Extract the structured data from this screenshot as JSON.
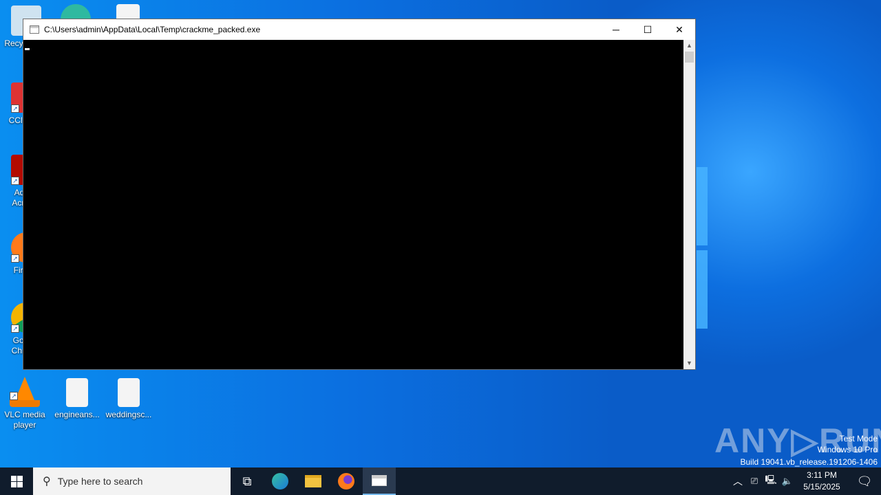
{
  "desktop": {
    "icons": [
      {
        "label": "Recycle Bin",
        "icon": "recycle-bin-icon"
      },
      {
        "label": "CCleaner",
        "icon": "ccleaner-icon"
      },
      {
        "label": "Adobe Acrobat",
        "icon": "acrobat-icon"
      },
      {
        "label": "Firefox",
        "icon": "firefox-icon"
      },
      {
        "label": "Google Chrome",
        "icon": "chrome-icon"
      },
      {
        "label": "VLC media player",
        "icon": "vlc-icon"
      },
      {
        "label": "engineans...",
        "icon": "image-file-icon"
      },
      {
        "label": "weddingsc...",
        "icon": "image-file-icon"
      }
    ]
  },
  "window": {
    "title": "C:\\Users\\admin\\AppData\\Local\\Temp\\crackme_packed.exe",
    "minimize": "─",
    "maximize": "☐",
    "close": "✕"
  },
  "watermark": {
    "brand": "ANY▷RUN",
    "line1": "Test Mode",
    "line2": "Windows 10 Pro",
    "line3": "Build 19041.vb_release.191206-1406"
  },
  "taskbar": {
    "search_placeholder": "Type here to search",
    "time": "3:11 PM",
    "date": "5/15/2025"
  },
  "colors": {
    "console_bg": "#000000",
    "taskbar": "#101c2c",
    "accent": "#0a74e0"
  }
}
